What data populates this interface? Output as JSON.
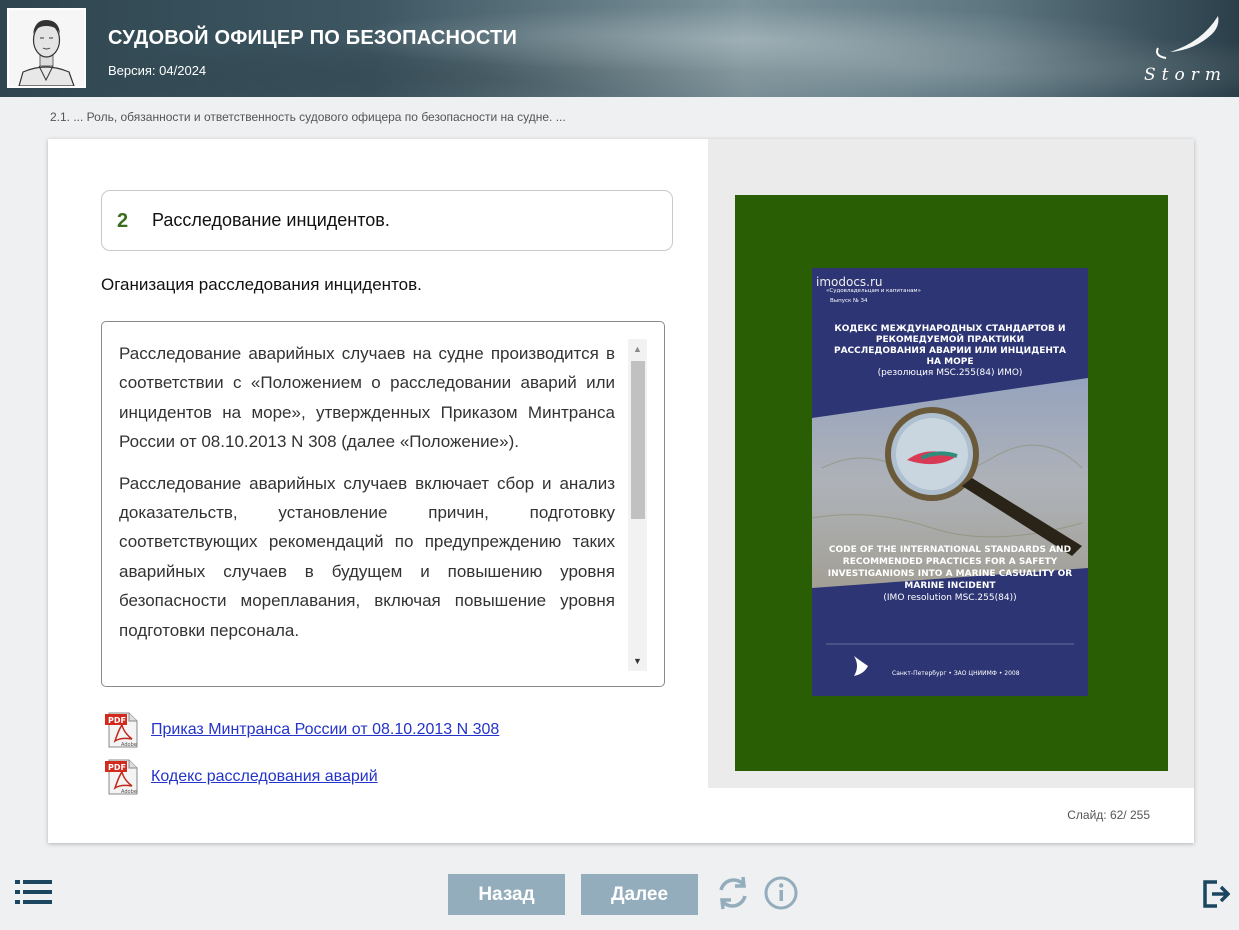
{
  "header": {
    "title": "СУДОВОЙ ОФИЦЕР ПО БЕЗОПАСНОСТИ",
    "version": "Версия: 04/2024",
    "logo_text": "Storm"
  },
  "breadcrumb": "2.1. ... Роль, обязанности и ответственность судового офицера по безопасности на судне. ...",
  "section": {
    "number": "2",
    "title": "Расследование инцидентов."
  },
  "subtitle": "Оганизация расследования инцидентов.",
  "text_paragraphs": [
    "Расследование аварийных случаев на судне производится в соответствии с «Положением о расследовании аварий или инцидентов на море», утвержденных Приказом Минтранса России от 08.10.2013 N 308 (далее «Положение»).",
    "Расследование аварийных случаев включает сбор и анализ доказательств, установление причин, подготовку соответствующих рекомендаций по предупреждению таких аварийных случаев в будущем и повышению уровня безопасности мореплавания, включая повышение уровня подготовки персонала."
  ],
  "links": [
    {
      "label": "Приказ Минтранса России от 08.10.2013 N 308",
      "icon": "pdf-icon"
    },
    {
      "label": "Кодекс расследования аварий",
      "icon": "pdf-icon"
    }
  ],
  "book": {
    "watermark": "imodocs.ru",
    "series": "«Судовладельцам и капитанам»",
    "issue": "Выпуск № 34",
    "title_ru": "КОДЕКС МЕЖДУНАРОДНЫХ СТАНДАРТОВ И РЕКОМЕДУЕМОЙ ПРАКТИКИ РАССЛЕДОВАНИЯ АВАРИИ ИЛИ ИНЦИДЕНТА НА МОРЕ",
    "resolution_ru": "(резолюция MSC.255(84) ИМО)",
    "title_en": "CODE OF THE INTERNATIONAL STANDARDS AND RECOMMENDED PRACTICES FOR A SAFETY INVESTIGANIONS INTO A MARINE CASUALITY OR MARINE INCIDENT",
    "resolution_en": "(IMO resolution MSC.255(84))",
    "publisher": "Санкт-Петербург • ЗАО ЦНИИМФ • 2008"
  },
  "slide_counter": "Слайд:  62/ 255",
  "nav": {
    "back_label": "Назад",
    "next_label": "Далее"
  },
  "colors": {
    "header_bg": "#3d5661",
    "accent_green": "#2a5e05",
    "section_number": "#3a6d1f",
    "nav_button": "#94adbd",
    "link": "#2433c9",
    "icon": "#1b4660"
  }
}
